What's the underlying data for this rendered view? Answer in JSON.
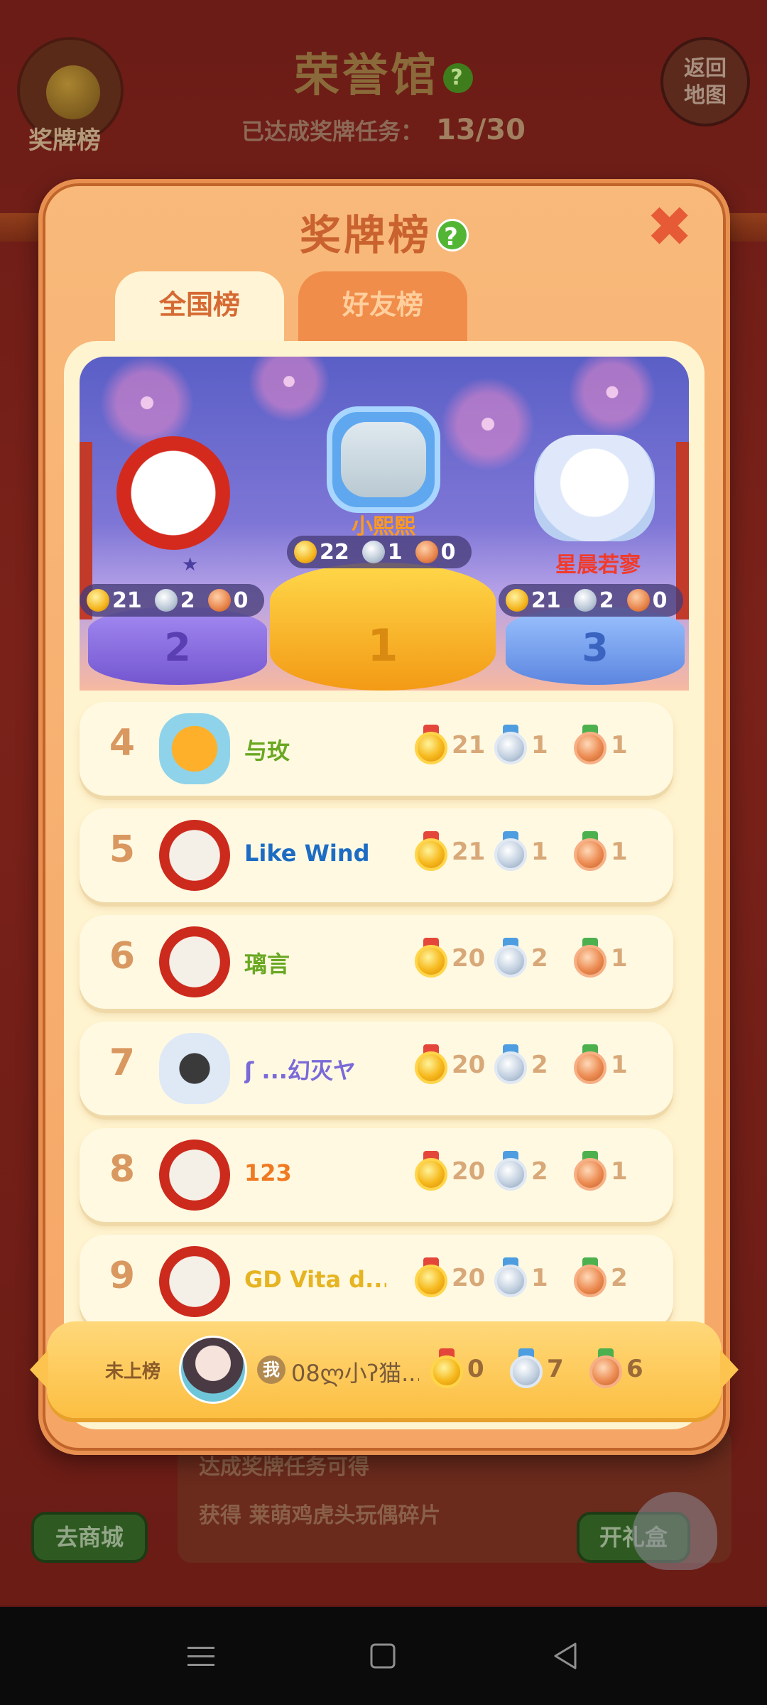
{
  "background": {
    "hall_title": "荣誉馆",
    "medal_button_label": "奖牌榜",
    "back_button_label": "返回\n地图",
    "progress_label": "已达成奖牌任务：",
    "progress_value": "13/30",
    "bottom_text_1": "达成奖牌任务可得",
    "bottom_text_2_a": "获得",
    "bottom_text_2_b": "莱萌鸡虎头玩偶碎片",
    "shop_button": "去商城",
    "gift_button": "开礼盒"
  },
  "modal": {
    "title": "奖牌榜",
    "help_glyph": "?",
    "close_glyph": "✖",
    "tabs": [
      {
        "label": "全国榜",
        "active": true
      },
      {
        "label": "好友榜",
        "active": false
      }
    ]
  },
  "podium": {
    "first": {
      "rank": "1",
      "name": "小熙熙",
      "gold": "22",
      "silver": "1",
      "bronze": "0"
    },
    "second": {
      "rank": "2",
      "name": "",
      "gold": "21",
      "silver": "2",
      "bronze": "0",
      "star": "★"
    },
    "third": {
      "rank": "3",
      "name": "星晨若寥",
      "gold": "21",
      "silver": "2",
      "bronze": "0"
    }
  },
  "rows": [
    {
      "rank": "4",
      "name": "与玫",
      "name_color": "#6aa822",
      "frame": "dog",
      "gold": "21",
      "silver": "1",
      "bronze": "1"
    },
    {
      "rank": "5",
      "name": "Like  Wind",
      "name_color": "#1d6cc4",
      "frame": "tiger",
      "gold": "21",
      "silver": "1",
      "bronze": "1"
    },
    {
      "rank": "6",
      "name": "璃言",
      "name_color": "#6aa822",
      "frame": "tiger",
      "gold": "20",
      "silver": "2",
      "bronze": "1"
    },
    {
      "rank": "7",
      "name": "ʃ ...幻灭ヤ",
      "name_color": "#7a6ad8",
      "frame": "ghost",
      "gold": "20",
      "silver": "2",
      "bronze": "1"
    },
    {
      "rank": "8",
      "name": "123",
      "name_color": "#f07a22",
      "frame": "tiger",
      "gold": "20",
      "silver": "2",
      "bronze": "1"
    },
    {
      "rank": "9",
      "name": "GD Vita d...",
      "name_color": "#e6b422",
      "frame": "tiger",
      "gold": "20",
      "silver": "1",
      "bronze": "2"
    }
  ],
  "me": {
    "status": "未上榜",
    "badge": "我",
    "name": "08ლ小ʔ猫...",
    "gold": "0",
    "silver": "7",
    "bronze": "6"
  },
  "colors": {
    "modal_bg": "#f8b97a",
    "panel_bg": "#fff4d0",
    "rank_number": "#d99860",
    "help_green": "#52b634",
    "close_red": "#e65a36"
  }
}
